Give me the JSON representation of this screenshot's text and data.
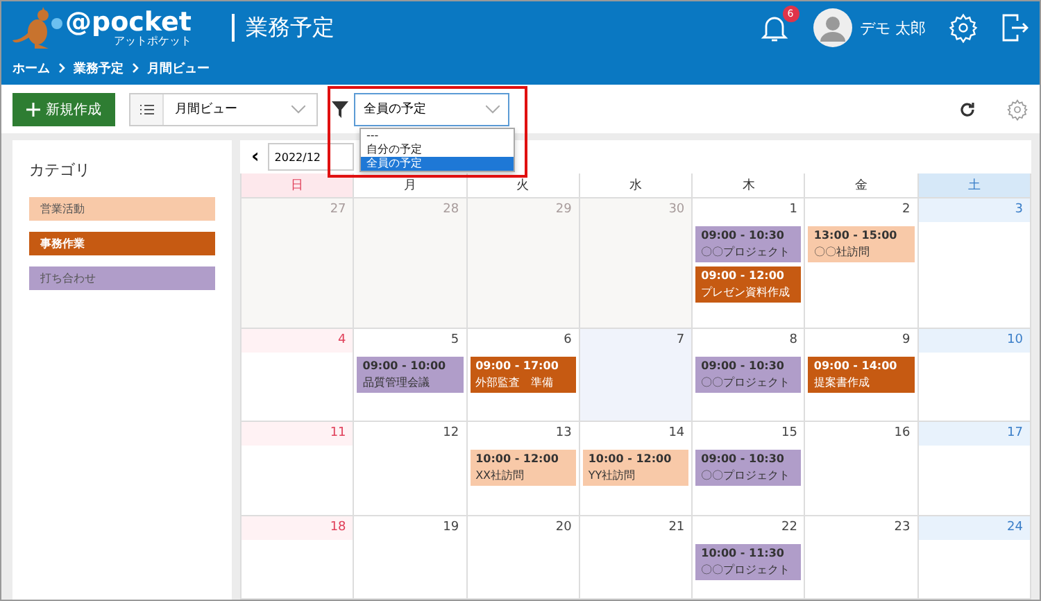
{
  "header": {
    "logo": "@pocket",
    "logo_sub": "アットポケット",
    "title": "業務予定",
    "breadcrumbs": [
      "ホーム",
      "業務予定",
      "月間ビュー"
    ],
    "notification_count": "6",
    "user_name": "デモ 太郎"
  },
  "toolbar": {
    "new_button": "新規作成",
    "view_select": "月間ビュー",
    "filter_select": "全員の予定",
    "filter_options": [
      {
        "label": "---",
        "selected": false
      },
      {
        "label": "自分の予定",
        "selected": false
      },
      {
        "label": "全員の予定",
        "selected": true
      }
    ]
  },
  "sidebar": {
    "title": "カテゴリ",
    "categories": [
      {
        "label": "営業活動",
        "color": "#f8c9a8"
      },
      {
        "label": "事務作業",
        "color": "#c65a12"
      },
      {
        "label": "打ち合わせ",
        "color": "#b09dc9"
      }
    ]
  },
  "calendar": {
    "prev": "‹",
    "month": "2022/12",
    "weekdays": [
      "日",
      "月",
      "火",
      "水",
      "木",
      "金",
      "土"
    ],
    "weeks": [
      {
        "days": [
          {
            "date": "27",
            "other_month": true,
            "today": false
          },
          {
            "date": "28",
            "other_month": true,
            "today": false
          },
          {
            "date": "29",
            "other_month": true,
            "today": false
          },
          {
            "date": "30",
            "other_month": true,
            "today": false
          },
          {
            "date": "1",
            "other_month": false,
            "today": false,
            "events": [
              {
                "time": "09:00 - 10:30",
                "title": "〇〇プロジェクト",
                "color": "#b09dc9"
              },
              {
                "time": "09:00 - 12:00",
                "title": "プレゼン資料作成",
                "color": "#c65a12"
              }
            ]
          },
          {
            "date": "2",
            "other_month": false,
            "today": false,
            "events": [
              {
                "time": "13:00 - 15:00",
                "title": "〇〇社訪問",
                "color": "#f8c9a8"
              }
            ]
          },
          {
            "date": "3",
            "other_month": false,
            "today": false
          }
        ]
      },
      {
        "days": [
          {
            "date": "4",
            "other_month": false,
            "today": false
          },
          {
            "date": "5",
            "other_month": false,
            "today": false,
            "events": [
              {
                "time": "09:00 - 10:00",
                "title": "品質管理会議",
                "color": "#b09dc9"
              }
            ]
          },
          {
            "date": "6",
            "other_month": false,
            "today": false,
            "events": [
              {
                "time": "09:00 - 17:00",
                "title": "外部監査　準備",
                "color": "#c65a12"
              }
            ]
          },
          {
            "date": "7",
            "other_month": false,
            "today": true
          },
          {
            "date": "8",
            "other_month": false,
            "today": false,
            "events": [
              {
                "time": "09:00 - 10:30",
                "title": "〇〇プロジェクト",
                "color": "#b09dc9"
              }
            ]
          },
          {
            "date": "9",
            "other_month": false,
            "today": false,
            "events": [
              {
                "time": "09:00 - 14:00",
                "title": "提案書作成",
                "color": "#c65a12"
              }
            ]
          },
          {
            "date": "10",
            "other_month": false,
            "today": false
          }
        ]
      },
      {
        "days": [
          {
            "date": "11",
            "other_month": false,
            "today": false
          },
          {
            "date": "12",
            "other_month": false,
            "today": false
          },
          {
            "date": "13",
            "other_month": false,
            "today": false,
            "events": [
              {
                "time": "10:00 - 12:00",
                "title": "XX社訪問",
                "color": "#f8c9a8"
              }
            ]
          },
          {
            "date": "14",
            "other_month": false,
            "today": false,
            "events": [
              {
                "time": "10:00 - 12:00",
                "title": "YY社訪問",
                "color": "#f8c9a8"
              }
            ]
          },
          {
            "date": "15",
            "other_month": false,
            "today": false,
            "events": [
              {
                "time": "09:00 - 10:30",
                "title": "〇〇プロジェクト",
                "color": "#b09dc9"
              }
            ]
          },
          {
            "date": "16",
            "other_month": false,
            "today": false
          },
          {
            "date": "17",
            "other_month": false,
            "today": false
          }
        ]
      },
      {
        "days": [
          {
            "date": "18",
            "other_month": false,
            "today": false
          },
          {
            "date": "19",
            "other_month": false,
            "today": false
          },
          {
            "date": "20",
            "other_month": false,
            "today": false
          },
          {
            "date": "21",
            "other_month": false,
            "today": false
          },
          {
            "date": "22",
            "other_month": false,
            "today": false,
            "events": [
              {
                "time": "10:00 - 11:30",
                "title": "〇〇プロジェクト",
                "color": "#b09dc9"
              }
            ]
          },
          {
            "date": "23",
            "other_month": false,
            "today": false
          },
          {
            "date": "24",
            "other_month": false,
            "today": false
          }
        ]
      }
    ]
  }
}
